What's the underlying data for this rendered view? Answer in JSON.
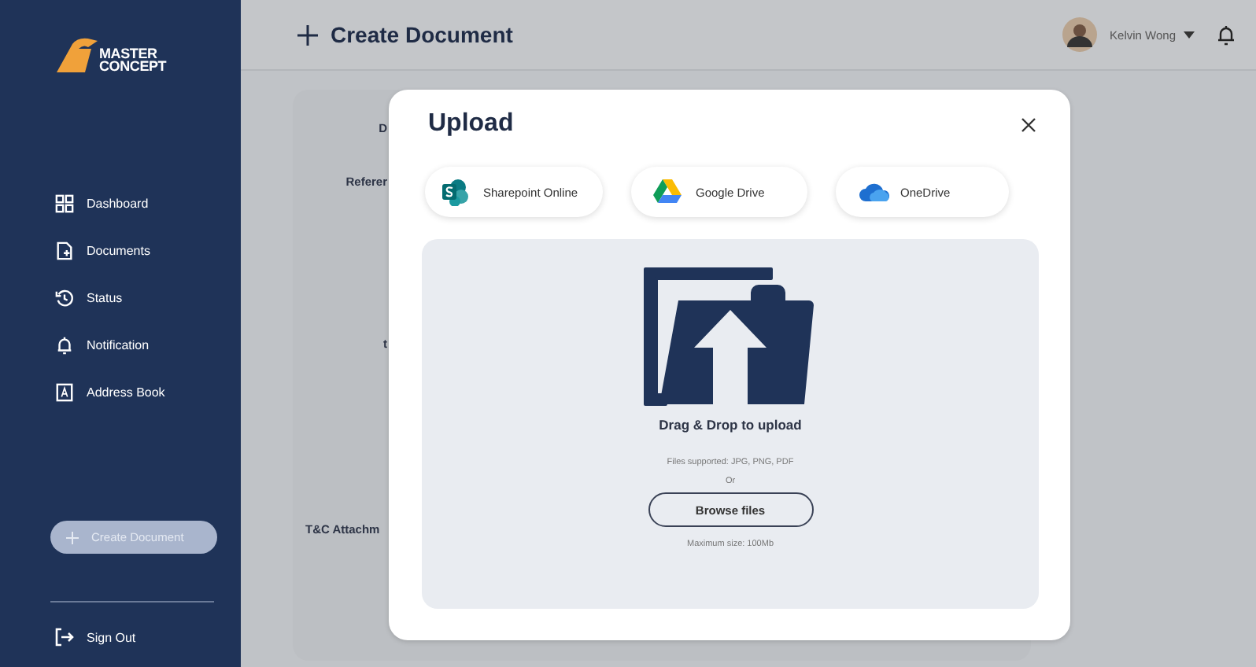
{
  "sidebar": {
    "logo": {
      "line_1": "MASTER",
      "line_2": "CONCEPT"
    },
    "nav": [
      {
        "label": "Dashboard",
        "kind": "dashboard"
      },
      {
        "label": "Documents",
        "kind": "documents"
      },
      {
        "label": "Status",
        "kind": "status"
      },
      {
        "label": "Notification",
        "kind": "notification"
      },
      {
        "label": "Address Book",
        "kind": "address"
      }
    ],
    "create_button": "Create Document",
    "sign_out": "Sign Out"
  },
  "header": {
    "title": "Create Document",
    "user": "Kelvin Wong"
  },
  "form": {
    "labels": [
      "D",
      "Referer",
      "t",
      "T&C Attachm"
    ]
  },
  "modal": {
    "title": "Upload",
    "sources": [
      {
        "label": "Sharepoint Online",
        "kind": "sharepoint"
      },
      {
        "label": "Google Drive",
        "kind": "gdrive"
      },
      {
        "label": "OneDrive",
        "kind": "onedrive"
      }
    ],
    "drop": {
      "heading": "Drag & Drop to upload",
      "supported": "Files supported: JPG, PNG, PDF",
      "or": "Or",
      "button": "Browse files",
      "max": "Maximum size: 100Mb"
    }
  }
}
